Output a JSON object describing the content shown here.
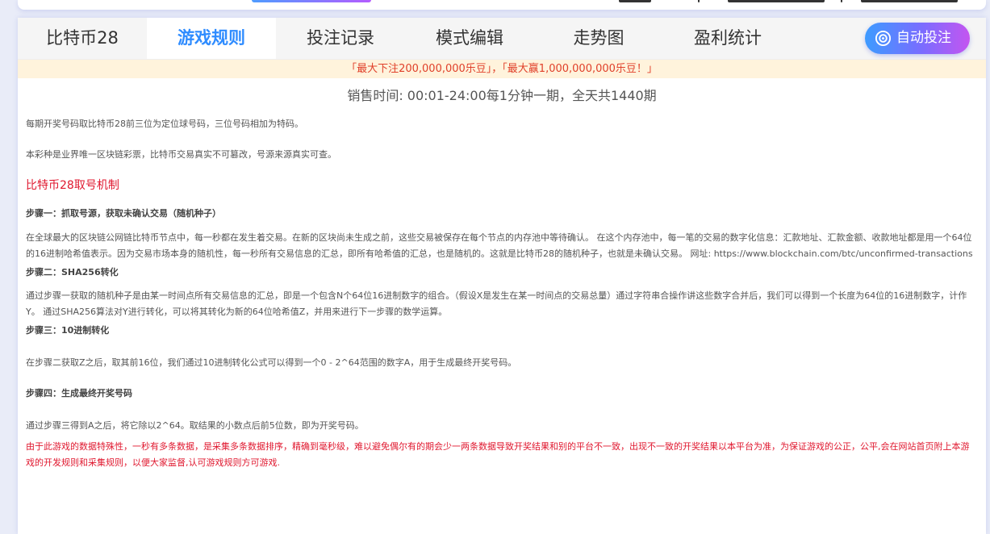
{
  "tabs": [
    {
      "label": "比特币28",
      "active": false
    },
    {
      "label": "游戏规则",
      "active": true
    },
    {
      "label": "投注记录",
      "active": false
    },
    {
      "label": "模式编辑",
      "active": false
    },
    {
      "label": "走势图",
      "active": false
    },
    {
      "label": "盈利统计",
      "active": false
    }
  ],
  "auto_bet": {
    "label": "自动投注",
    "icon": "target-icon",
    "gradient": [
      "#3d9bff",
      "#c455f0"
    ]
  },
  "notice": "「最大下注200,000,000乐豆」，「最大赢1,000,000,000乐豆！」",
  "sale_time": "销售时间: 00:01-24:00每1分钟一期，全天共1440期",
  "intro": [
    "每期开奖号码取比特币28前三位为定位球号码，三位号码相加为特码。",
    "本彩种是业界唯一区块链彩票，比特币交易真实不可篡改，号源来源真实可查。"
  ],
  "section_title": "比特币28取号机制",
  "steps": [
    {
      "title": "步骤一：抓取号源，获取未确认交易（随机种子）",
      "text": "在全球最大的区块链公网链比特币节点中，每一秒都在发生着交易。在新的区块尚未生成之前，这些交易被保存在每个节点的内存池中等待确认。 在这个内存池中，每一笔的交易的数字化信息：汇款地址、汇款金额、收款地址都是用一个64位的16进制哈希值表示。因为交易市场本身的随机性，每一秒所有交易信息的汇总，即所有哈希值的汇总，也是随机的。这就是比特币28的随机种子，也就是未确认交易。 网址: https://www.blockchain.com/btc/unconfirmed-transactions"
    },
    {
      "title": "步骤二：SHA256转化",
      "text": "通过步骤一获取的随机种子是由某一时间点所有交易信息的汇总，即是一个包含N个64位16进制数字的组合。（假设X是发生在某一时间点的交易总量）通过字符串合操作讲这些数字合并后，我们可以得到一个长度为64位的16进制数字，计作Y。 通过SHA256算法对Y进行转化，可以将其转化为新的64位哈希值Z，并用来进行下一步骤的数学运算。"
    },
    {
      "title": "步骤三：10进制转化",
      "text": "在步骤二获取Z之后，取其前16位，我们通过10进制转化公式可以得到一个0 - 2^64范围的数字A，用于生成最终开奖号码。"
    },
    {
      "title": "步骤四：生成最终开奖号码",
      "text": "通过步骤三得到A之后，将它除以2^64。取结果的小数点后前5位数，即为开奖号码。"
    }
  ],
  "warning": "由于此游戏的数据特殊性，一秒有多条数据，是采集多条数据排序，精确到毫秒级，难以避免偶尔有的期会少一两条数据导致开奖结果和别的平台不一致，出现不一致的开奖结果以本平台为准，为保证游戏的公正，公平,会在网站首页附上本游戏的开发规则和采集规则，以便大家监督,认可游戏规则方可游戏."
}
